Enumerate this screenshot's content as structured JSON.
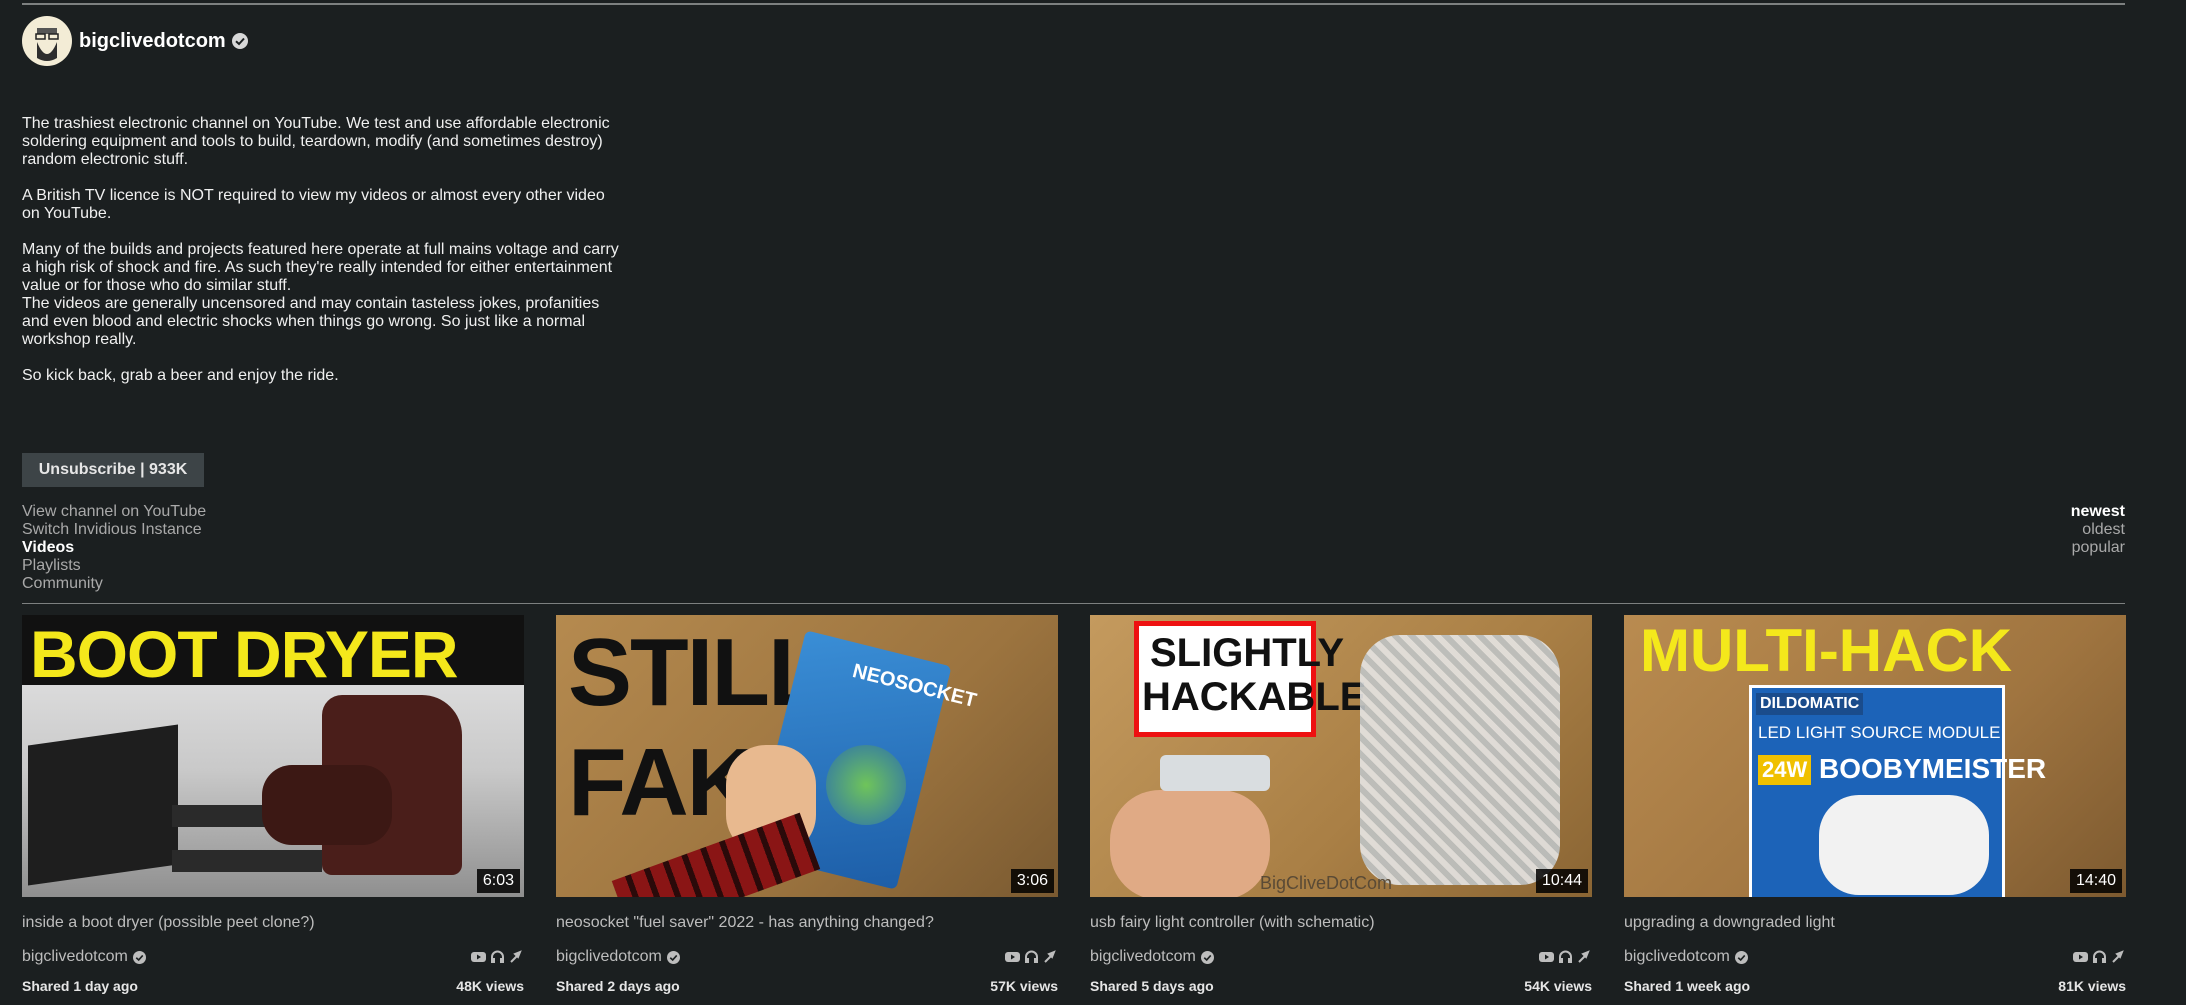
{
  "channel": {
    "name": "bigclivedotcom",
    "description": [
      "The trashiest electronic channel on YouTube.  We test and use affordable electronic\nsoldering equipment and tools to build, teardown, modify (and sometimes destroy)\nrandom electronic stuff.",
      "A British TV licence is NOT required to view my videos or almost every other video\non YouTube.",
      "Many of the builds and projects featured here operate at full mains voltage and carry\na high risk of shock and fire.  As such they're really intended for either entertainment\nvalue or for those who do similar stuff.\nThe videos are generally uncensored and may contain tasteless jokes, profanities\nand even blood and electric shocks when things go wrong.  So just like a normal\nworkshop really.",
      "So kick back, grab a beer and enjoy the ride."
    ],
    "subscribe_label": "Unsubscribe | 933K"
  },
  "nav": {
    "items": [
      "View channel on YouTube",
      "Switch Invidious Instance",
      "Videos",
      "Playlists",
      "Community"
    ],
    "active": "Videos"
  },
  "sort": {
    "items": [
      "newest",
      "oldest",
      "popular"
    ],
    "active": "newest"
  },
  "videos": [
    {
      "thumb_text": "BOOT DRYER",
      "duration": "6:03",
      "title": "inside a boot dryer (possible peet clone?)",
      "author": "bigclivedotcom",
      "shared": "Shared 1 day ago",
      "views": "48K views"
    },
    {
      "thumb_text": "STILL FAKE",
      "thumb_line1": "STILL",
      "thumb_line2": "FAKE",
      "box_text": "NEOSOCKET",
      "duration": "3:06",
      "title": "neosocket \"fuel saver\" 2022 - has anything changed?",
      "author": "bigclivedotcom",
      "shared": "Shared 2 days ago",
      "views": "57K views"
    },
    {
      "thumb_line1": "SLIGHTLY",
      "thumb_line2": "HACKABLE",
      "watermark": "BigCliveDotCom",
      "duration": "10:44",
      "title": "usb fairy light controller (with schematic)",
      "author": "bigclivedotcom",
      "shared": "Shared 5 days ago",
      "views": "54K views"
    },
    {
      "thumb_text": "MULTI-HACK",
      "box_brand": "DILDOMATIC",
      "box_line1": "LED LIGHT SOURCE MODULE",
      "box_line2": "BOOBYMEISTER",
      "box_watt": "24W",
      "duration": "14:40",
      "title": "upgrading a downgraded light",
      "author": "bigclivedotcom",
      "shared": "Shared 1 week ago",
      "views": "81K views"
    }
  ],
  "colors": {
    "background": "#1b1f20",
    "thumb_yellow": "#f4e81b",
    "button_bg": "#3d4447"
  },
  "icons": [
    "verified-icon",
    "youtube-icon",
    "headphones-icon",
    "redirect-icon"
  ]
}
